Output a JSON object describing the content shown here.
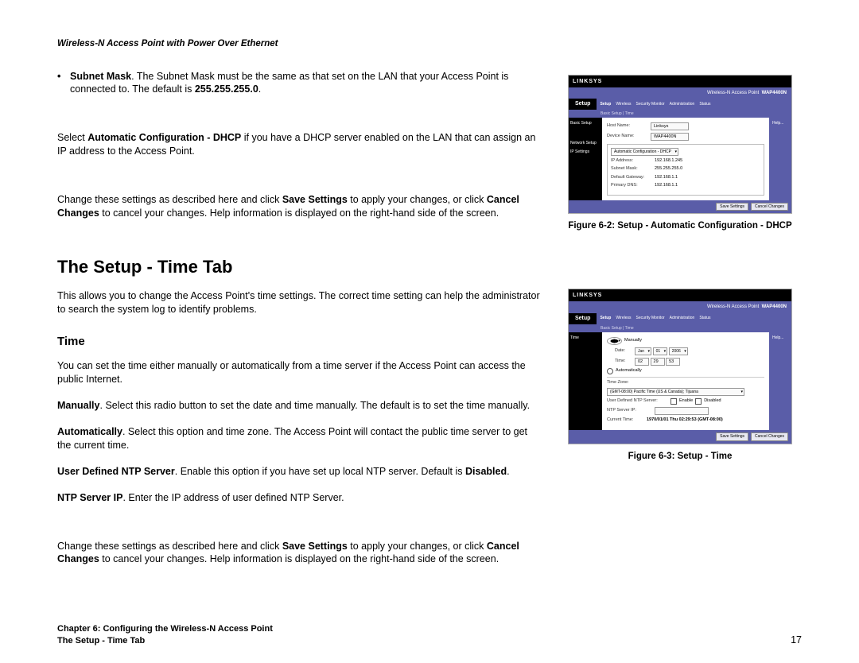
{
  "header": {
    "title": "Wireless-N Access Point with Power Over Ethernet"
  },
  "bullet1": {
    "label": "Subnet Mask",
    "text": ". The Subnet Mask must be the same as that set on the LAN that your Access Point is connected to. The default is ",
    "default": "255.255.255.0",
    "suffix": "."
  },
  "para_dhcp_pre": "Select ",
  "para_dhcp_bold": "Automatic Configuration - DHCP",
  "para_dhcp_post": " if you have a DHCP server enabled on the LAN that can assign an IP address to the Access Point.",
  "para_save_pre": "Change these settings as described here and click ",
  "para_save_b1": "Save Settings",
  "para_save_mid": " to apply your changes, or click ",
  "para_save_b2": "Cancel Changes",
  "para_save_post": " to cancel your changes. Help information is displayed on the right-hand side of the screen.",
  "h2_time": "The Setup - Time Tab",
  "para_time_intro": "This allows you to change the Access Point's time settings. The correct time setting can help the administrator to search the system log to identify problems.",
  "h3_time": "Time",
  "para_time_desc": "You can set the time either manually or automatically from a time server if the Access Point can access the public Internet.",
  "manual_b": "Manually",
  "manual_t": ". Select this radio button to set the date and time manually. The default is to set the time manually.",
  "auto_b": "Automatically",
  "auto_t": ". Select this option and time zone. The Access Point will contact the public time server to get the current time.",
  "ntp_b": "User Defined NTP Server",
  "ntp_mid": ". Enable this option if you have set up local NTP server. Default is ",
  "ntp_b2": "Disabled",
  "ntp_suffix": ".",
  "ntpip_b": "NTP Server IP",
  "ntpip_t": ". Enter the IP address of user defined NTP Server.",
  "fig2_caption": "Figure 6-2: Setup - Automatic Configuration - DHCP",
  "fig3_caption": "Figure 6-3: Setup - Time",
  "footer": {
    "chapter": "Chapter 6: Configuring the Wireless-N Access Point",
    "section": "The Setup - Time Tab",
    "page": "17"
  },
  "shot1": {
    "brand": "LINKSYS",
    "banner": "Wireless-N Access Point",
    "model": "WAP4400N",
    "setup": "Setup",
    "tabs": [
      "Setup",
      "Wireless",
      "Security Monitor",
      "Administration",
      "Status"
    ],
    "subtabs": "Basic Setup  |  Time",
    "side1": "Basic Setup",
    "side2": "Network Setup",
    "side3": "IP Settings",
    "hostname_l": "Host Name:",
    "hostname_v": "Linksys",
    "devname_l": "Device Name:",
    "devname_v": "WAP4400N",
    "dhcp_option": "Automatic Configuration - DHCP",
    "ip_l": "IP Address:",
    "ip_v": "192.168.1.245",
    "mask_l": "Subnet Mask:",
    "mask_v": "255.255.255.0",
    "gw_l": "Default Gateway:",
    "gw_v": "192.168.1.1",
    "dns_l": "Primary DNS:",
    "dns_v": "192.168.1.1",
    "save": "Save Settings",
    "cancel": "Cancel Changes",
    "help": "Help..."
  },
  "shot2": {
    "brand": "LINKSYS",
    "banner": "Wireless-N Access Point",
    "model": "WAP4400N",
    "setup": "Setup",
    "tabs": [
      "Setup",
      "Wireless",
      "Security Monitor",
      "Administration",
      "Status"
    ],
    "subtabs": "Basic Setup  |  Time",
    "side1": "Time",
    "manually": "Manually",
    "date_l": "Date:",
    "date_m": "Jan",
    "date_d": "01",
    "date_y": "2006",
    "time_l": "Time:",
    "time_h": "02",
    "time_mi": "29",
    "time_s": "53",
    "auto": "Automatically",
    "tz_l": "Time Zone:",
    "tz_v": "(GMT-08:00) Pacific Time (US & Canada); Tijuana",
    "udntp_l": "User Defined NTP Server:",
    "udntp_en": "Enable",
    "udntp_dis": "Disabled",
    "ntpip_l": "NTP Server IP:",
    "cur_l": "Current Time:",
    "cur_v": "1970/01/01 Thu 02:29:53 (GMT-08:00)",
    "save": "Save Settings",
    "cancel": "Cancel Changes",
    "help": "Help..."
  }
}
